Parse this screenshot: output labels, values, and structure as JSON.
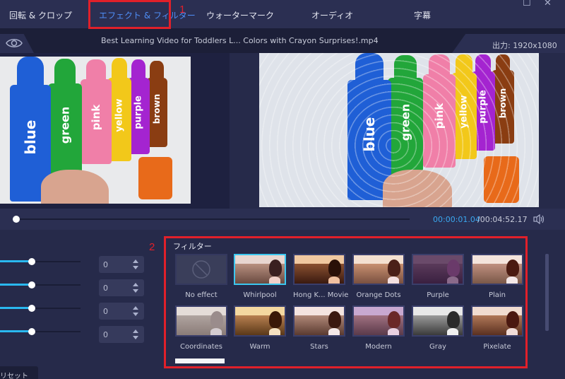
{
  "tabs": [
    {
      "label": "回転 & クロップ",
      "active": false
    },
    {
      "label": "エフェクト & フィルター",
      "active": true
    },
    {
      "label": "ウォーターマーク",
      "active": false
    },
    {
      "label": "オーディオ",
      "active": false
    },
    {
      "label": "字幕",
      "active": false
    }
  ],
  "window_controls": {
    "maximize": "☐",
    "close": "✕"
  },
  "annotations": [
    "1",
    "2"
  ],
  "file": {
    "name": "Best Learning Video for Toddlers L... Colors with Crayon Surprises!.mp4",
    "output": "出力: 1920x1080"
  },
  "preview": {
    "crayon_labels": [
      "blue",
      "green",
      "pink",
      "yellow",
      "purple",
      "brown"
    ],
    "crayon_colors": [
      "#1f5fd6",
      "#22a63a",
      "#f07fa8",
      "#f2c81a",
      "#a424d0",
      "#8a3d12"
    ]
  },
  "playback": {
    "current_time": "00:00:01.04",
    "total_time": "/00:04:52.17",
    "progress": 0.004
  },
  "adjust": {
    "sliders": [
      {
        "value": "0",
        "fill": 0.5
      },
      {
        "value": "0",
        "fill": 0.5
      },
      {
        "value": "0",
        "fill": 0.5
      },
      {
        "value": "0",
        "fill": 0.5
      }
    ],
    "reset_label": "リセット"
  },
  "filters": {
    "title": "フィルター",
    "items": [
      {
        "name": "No effect",
        "selected": false,
        "tone": "none"
      },
      {
        "name": "Whirlpool",
        "selected": true,
        "tone": "whirl"
      },
      {
        "name": "Hong K... Movie",
        "selected": false,
        "tone": "hk"
      },
      {
        "name": "Orange Dots",
        "selected": false,
        "tone": "orange"
      },
      {
        "name": "Purple",
        "selected": false,
        "tone": "purple"
      },
      {
        "name": "Plain",
        "selected": false,
        "tone": "plain"
      },
      {
        "name": "Coordinates",
        "selected": false,
        "tone": "coord"
      },
      {
        "name": "Warm",
        "selected": false,
        "tone": "warm"
      },
      {
        "name": "Stars",
        "selected": false,
        "tone": "stars"
      },
      {
        "name": "Modern",
        "selected": false,
        "tone": "modern"
      },
      {
        "name": "Gray",
        "selected": false,
        "tone": "gray"
      },
      {
        "name": "Pixelate",
        "selected": false,
        "tone": "pixel"
      }
    ]
  },
  "colors": {
    "accent": "#4f8ef7",
    "time_accent": "#3aa8f0",
    "annotation": "#e0202a",
    "selected_border": "#3cc7f0"
  }
}
